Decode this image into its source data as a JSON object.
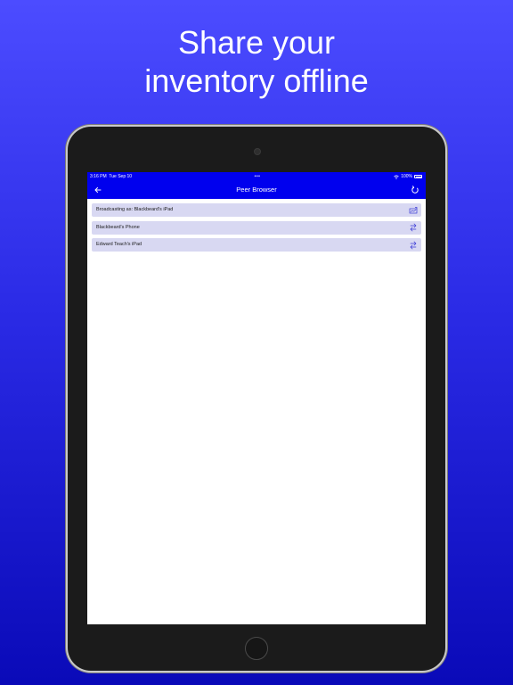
{
  "marketing": {
    "headline_line1": "Share your",
    "headline_line2": "inventory offline"
  },
  "status_bar": {
    "time": "3:16 PM",
    "date": "Tue Sep 10",
    "dots": "•••",
    "battery": "100%"
  },
  "navbar": {
    "title": "Peer Browser",
    "back_icon": "arrow-left-icon",
    "refresh_icon": "refresh-icon"
  },
  "peers": [
    {
      "label": "Broadcasting as: Blackbeard's iPad",
      "icon": "broadcast-icon"
    },
    {
      "label": "Blackbeard's Phone",
      "icon": "swap-icon"
    },
    {
      "label": "Edward Teach's iPad",
      "icon": "swap-icon"
    }
  ],
  "colors": {
    "accent": "#0000ee",
    "row_background": "#d8d8f2",
    "icon_color": "#3b3bd6",
    "background_top": "#4c4cff",
    "background_bottom": "#0a0ab8"
  }
}
